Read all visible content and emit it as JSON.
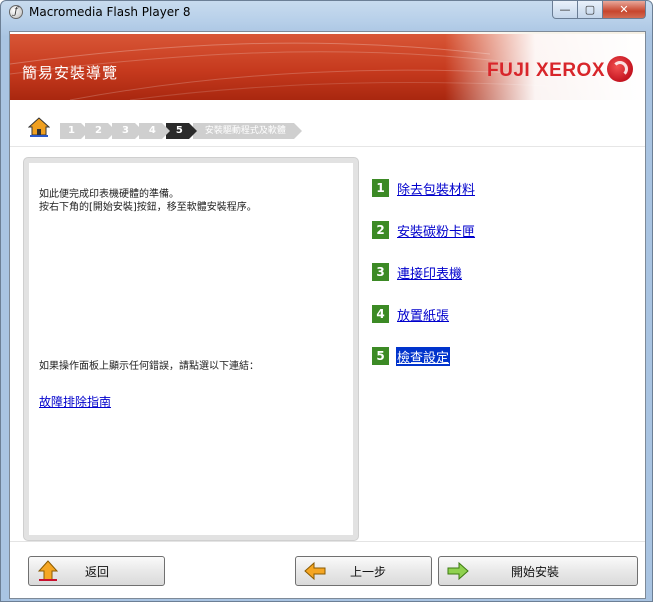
{
  "window": {
    "title": "Macromedia Flash Player 8",
    "controls": {
      "minimize": "—",
      "maximize": "▢",
      "close": "✕"
    }
  },
  "banner": {
    "title": "簡易安裝導覽",
    "brand": "FUJI XEROX",
    "brand_color": "#d8262b",
    "accent_color": "#c63a1e"
  },
  "stepnav": {
    "steps": [
      "1",
      "2",
      "3",
      "4",
      "5"
    ],
    "active_step": "5",
    "current_label": "安裝驅動程式及軟體"
  },
  "panel": {
    "line1": "如此便完成印表機硬體的準備。",
    "line2": "按右下角的[開始安裝]按鈕，移至軟體安裝程序。",
    "error_hint": "如果操作面板上顯示任何錯誤，請點選以下連結：",
    "trouble_link": "故障排除指南"
  },
  "tasks": [
    {
      "num": "1",
      "label": "除去包裝材料"
    },
    {
      "num": "2",
      "label": "安裝碳粉卡匣"
    },
    {
      "num": "3",
      "label": "連接印表機"
    },
    {
      "num": "4",
      "label": "放置紙張"
    },
    {
      "num": "5",
      "label": "檢查設定",
      "selected": true
    }
  ],
  "buttons": {
    "back": "返回",
    "prev": "上一步",
    "start": "開始安裝"
  }
}
